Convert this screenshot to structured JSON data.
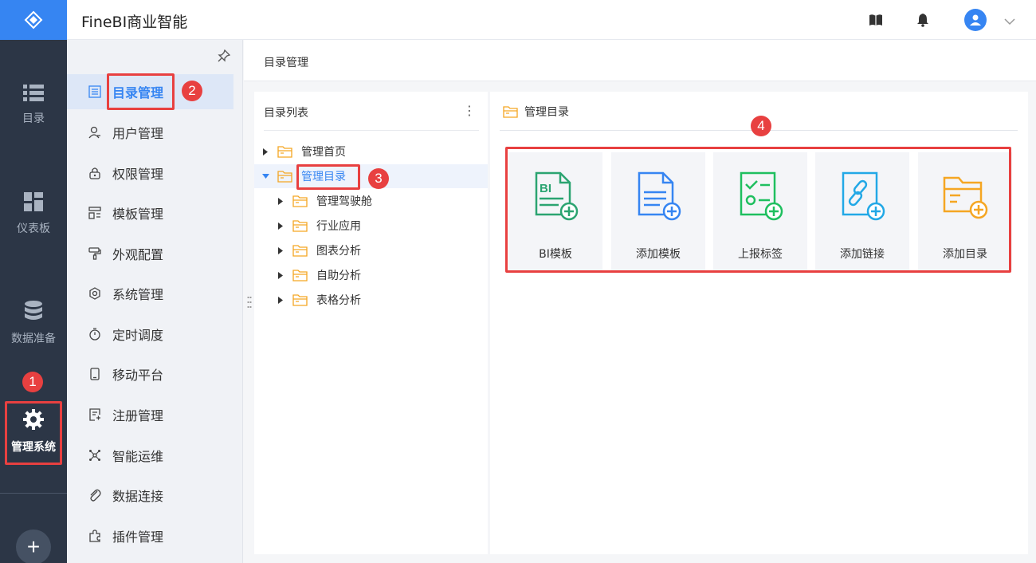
{
  "app": {
    "title": "FineBI商业智能"
  },
  "rail": {
    "items": [
      {
        "label": "目录",
        "icon": "list-icon"
      },
      {
        "label": "仪表板",
        "icon": "dashboard-icon"
      },
      {
        "label": "数据准备",
        "icon": "database-icon"
      },
      {
        "label": "管理系统",
        "icon": "gear-icon"
      }
    ],
    "add_symbol": "+"
  },
  "submenu": {
    "items": [
      {
        "label": "目录管理",
        "icon": "catalog-icon"
      },
      {
        "label": "用户管理",
        "icon": "user-icon"
      },
      {
        "label": "权限管理",
        "icon": "lock-icon"
      },
      {
        "label": "模板管理",
        "icon": "template-icon"
      },
      {
        "label": "外观配置",
        "icon": "brush-icon"
      },
      {
        "label": "系统管理",
        "icon": "settings-icon"
      },
      {
        "label": "定时调度",
        "icon": "timer-icon"
      },
      {
        "label": "移动平台",
        "icon": "mobile-icon"
      },
      {
        "label": "注册管理",
        "icon": "register-icon"
      },
      {
        "label": "智能运维",
        "icon": "ops-icon"
      },
      {
        "label": "数据连接",
        "icon": "link-icon"
      },
      {
        "label": "插件管理",
        "icon": "plugin-icon"
      }
    ],
    "active_index": 0
  },
  "breadcrumb": {
    "label": "目录管理"
  },
  "tree": {
    "title": "目录列表",
    "more_symbol": "⋮",
    "nodes": [
      {
        "label": "管理首页",
        "level": 0,
        "expanded": false
      },
      {
        "label": "管理目录",
        "level": 0,
        "expanded": true,
        "selected": true
      },
      {
        "label": "管理驾驶舱",
        "level": 1,
        "expanded": false
      },
      {
        "label": "行业应用",
        "level": 1,
        "expanded": false
      },
      {
        "label": "图表分析",
        "level": 1,
        "expanded": false
      },
      {
        "label": "自助分析",
        "level": 1,
        "expanded": false
      },
      {
        "label": "表格分析",
        "level": 1,
        "expanded": false
      }
    ]
  },
  "main": {
    "title": "管理目录",
    "cards": [
      {
        "label": "BI模板",
        "icon": "bi-template-add-icon",
        "color": "#2ba471"
      },
      {
        "label": "添加模板",
        "icon": "doc-add-icon",
        "color": "#3685f2"
      },
      {
        "label": "上报标签",
        "icon": "report-tag-add-icon",
        "color": "#1fbf5f"
      },
      {
        "label": "添加链接",
        "icon": "link-add-icon",
        "color": "#22a8e6"
      },
      {
        "label": "添加目录",
        "icon": "folder-add-icon",
        "color": "#f5a623"
      }
    ]
  },
  "annotations": [
    "1",
    "2",
    "3",
    "4"
  ],
  "colors": {
    "accent": "#3685f2",
    "rail_bg": "#2c3646",
    "folder": "#f5a623",
    "annotation": "#e84040"
  }
}
